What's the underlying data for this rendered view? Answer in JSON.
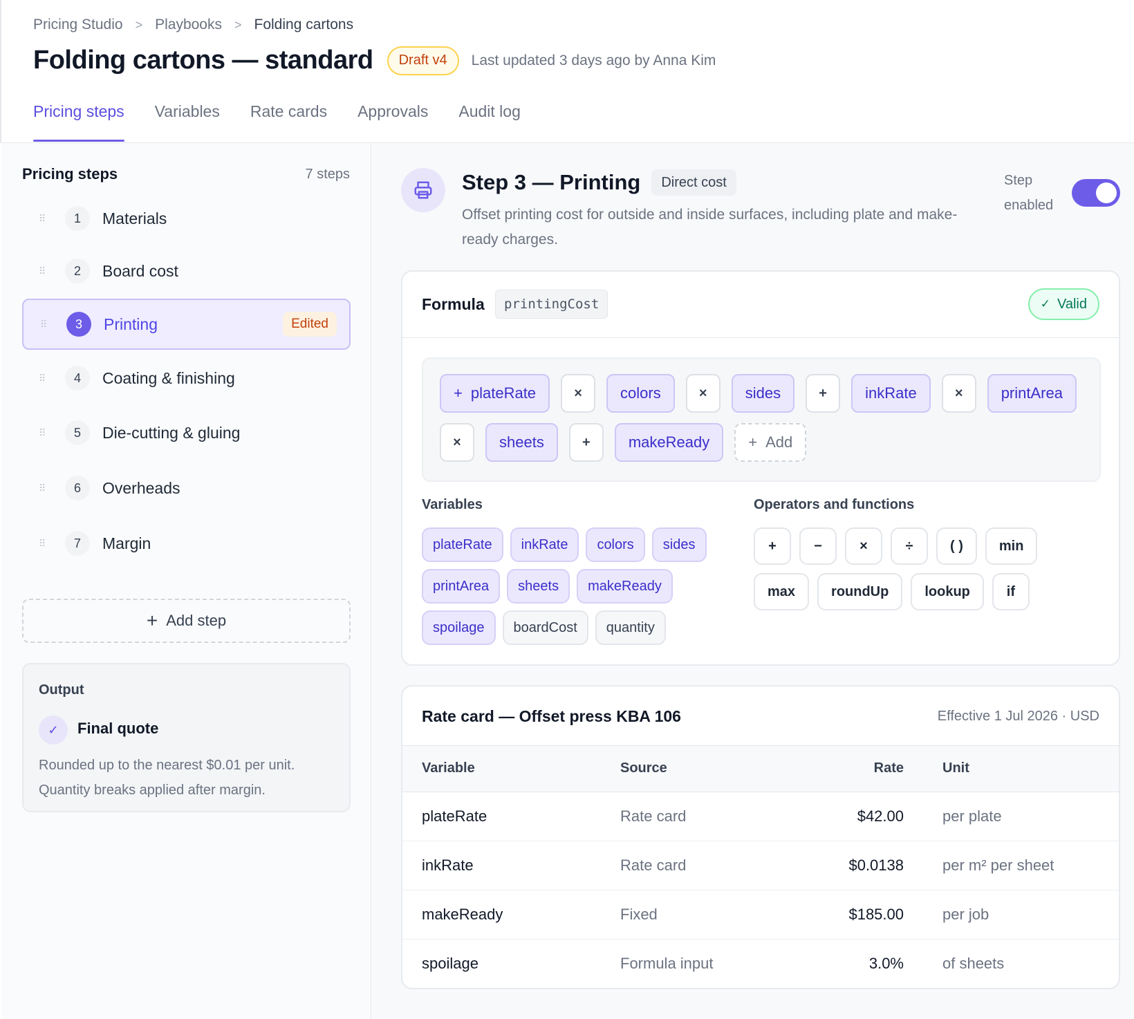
{
  "breadcrumb": {
    "items": [
      "Pricing Studio",
      "Playbooks",
      "Folding cartons"
    ],
    "separator": ">"
  },
  "page": {
    "title": "Folding cartons — standard",
    "status": "Draft v4",
    "updated": "Last updated 3 days ago by Anna Kim"
  },
  "tabs": [
    {
      "label": "Pricing steps",
      "active": true
    },
    {
      "label": "Variables"
    },
    {
      "label": "Rate cards"
    },
    {
      "label": "Approvals"
    },
    {
      "label": "Audit log"
    }
  ],
  "sidebar": {
    "title": "Pricing steps",
    "count": "7 steps",
    "steps": [
      {
        "num": "1",
        "label": "Materials"
      },
      {
        "num": "2",
        "label": "Board cost"
      },
      {
        "num": "3",
        "label": "Printing",
        "badge": "Edited",
        "active": true
      },
      {
        "num": "4",
        "label": "Coating & finishing"
      },
      {
        "num": "5",
        "label": "Die-cutting & gluing"
      },
      {
        "num": "6",
        "label": "Overheads"
      },
      {
        "num": "7",
        "label": "Margin"
      }
    ],
    "add_step": "Add step",
    "output": {
      "label": "Output",
      "title": "Final quote",
      "description": "Rounded up to the nearest $0.01 per unit. Quantity breaks applied after margin."
    }
  },
  "step": {
    "title": "Step 3 — Printing",
    "type": "Direct cost",
    "description": "Offset printing cost for outside and inside surfaces, including plate and make-ready charges.",
    "enabled_label": "Step enabled",
    "enabled": true,
    "icon": "printer-icon"
  },
  "formula": {
    "title": "Formula",
    "variable": "printingCost",
    "status": "Valid",
    "tokens": [
      {
        "type": "var",
        "text": "plateRate",
        "prefix": "+"
      },
      {
        "type": "op",
        "text": "×"
      },
      {
        "type": "var",
        "text": "colors"
      },
      {
        "type": "op",
        "text": "×"
      },
      {
        "type": "var",
        "text": "sides"
      },
      {
        "type": "op",
        "text": "+"
      },
      {
        "type": "var",
        "text": "inkRate"
      },
      {
        "type": "op",
        "text": "×"
      },
      {
        "type": "var",
        "text": "printArea"
      },
      {
        "type": "op",
        "text": "×"
      },
      {
        "type": "var",
        "text": "sheets"
      },
      {
        "type": "op",
        "text": "+"
      },
      {
        "type": "var",
        "text": "makeReady"
      },
      {
        "type": "add",
        "text": "Add",
        "prefix": "+"
      }
    ],
    "variables_label": "Variables",
    "variables": [
      {
        "text": "plateRate",
        "used": true
      },
      {
        "text": "inkRate",
        "used": true
      },
      {
        "text": "colors",
        "used": true
      },
      {
        "text": "sides",
        "used": true
      },
      {
        "text": "printArea",
        "used": true
      },
      {
        "text": "sheets",
        "used": true
      },
      {
        "text": "makeReady",
        "used": true
      },
      {
        "text": "spoilage",
        "used": true
      },
      {
        "text": "boardCost",
        "used": false
      },
      {
        "text": "quantity",
        "used": false
      }
    ],
    "operators_label": "Operators and functions",
    "operators": [
      "+",
      "−",
      "×",
      "÷",
      "( )",
      "min",
      "max",
      "roundUp",
      "lookup",
      "if"
    ]
  },
  "rate_card": {
    "title": "Rate card — Offset press KBA 106",
    "meta": "Effective 1 Jul 2026 · USD",
    "columns": [
      "Variable",
      "Source",
      "Rate",
      "Unit"
    ],
    "rows": [
      [
        "plateRate",
        "Rate card",
        "$42.00",
        "per plate"
      ],
      [
        "inkRate",
        "Rate card",
        "$0.0138",
        "per m² per sheet"
      ],
      [
        "makeReady",
        "Fixed",
        "$185.00",
        "per job"
      ],
      [
        "spoilage",
        "Formula input",
        "3.0%",
        "of sheets"
      ]
    ]
  },
  "colors": {
    "accent": "#6d5ce8",
    "accent_text": "#4f46e5",
    "valid": "#047857",
    "draft": "#c2410c"
  }
}
